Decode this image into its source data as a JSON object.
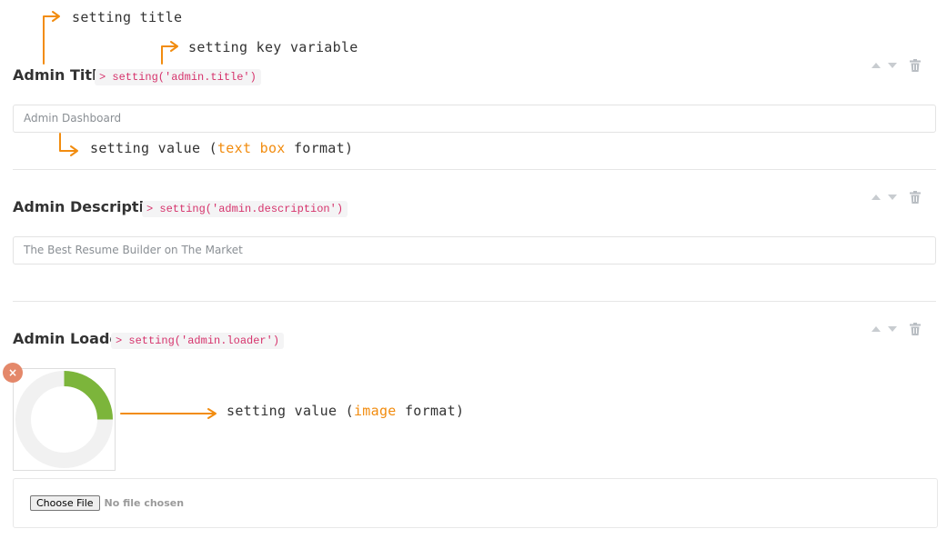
{
  "annotations": {
    "setting_title": "setting title",
    "setting_key": "setting key variable",
    "value_text_prefix": "setting value (",
    "value_text_highlight": "text box",
    "value_text_suffix": " format)",
    "value_image_prefix": "setting value (",
    "value_image_highlight": "image",
    "value_image_suffix": " format)",
    "arrow_color": "#f28c0f"
  },
  "settings": [
    {
      "title": "Admin Title",
      "key": "> setting('admin.title')",
      "value": "Admin Dashboard"
    },
    {
      "title": "Admin Description",
      "key": "> setting('admin.description')",
      "value": "The Best Resume Builder on The Market"
    },
    {
      "title": "Admin Loader",
      "key": "> setting('admin.loader')",
      "loader_progress": 0.25
    }
  ],
  "remove_label": "×",
  "file_input": {
    "button": "Choose File",
    "status": "No file chosen"
  },
  "icons": {
    "up": "arrow-up-icon",
    "down": "arrow-down-icon",
    "delete": "trash-icon",
    "remove": "close-icon"
  },
  "colors": {
    "code_text": "#d6336c",
    "loader": "#7cb53b",
    "loader_track": "#f1f1f1",
    "remove_badge": "#e4886a"
  }
}
